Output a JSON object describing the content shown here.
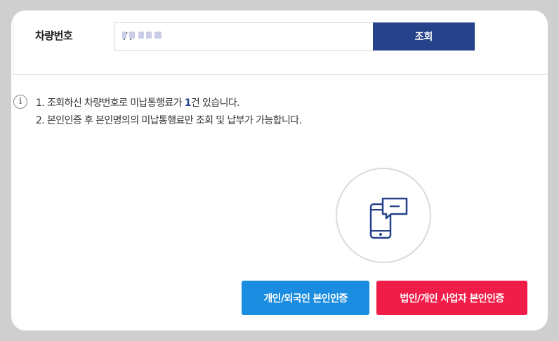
{
  "search": {
    "label": "차량번호",
    "plate_value": "77",
    "button_label": "조회"
  },
  "notices": {
    "line1_before": "1. 조회하신 차량번호로 미납통행료가 ",
    "line1_count": "1",
    "line1_after": "건 있습니다.",
    "line2": "2. 본인인증 후 본인명의의 미납통행료만 조회 및 납부가 가능합니다."
  },
  "auth": {
    "personal_label": "개인/외국인 본인인증",
    "business_label": "법인/개인 사업자 본인인증"
  },
  "colors": {
    "search_button": "#26428b",
    "personal_button": "#1a8de0",
    "business_button": "#f01d48",
    "icon_stroke": "#26428b"
  },
  "icons": {
    "phone": "mobile-phone-chat-icon",
    "info": "info-icon"
  }
}
